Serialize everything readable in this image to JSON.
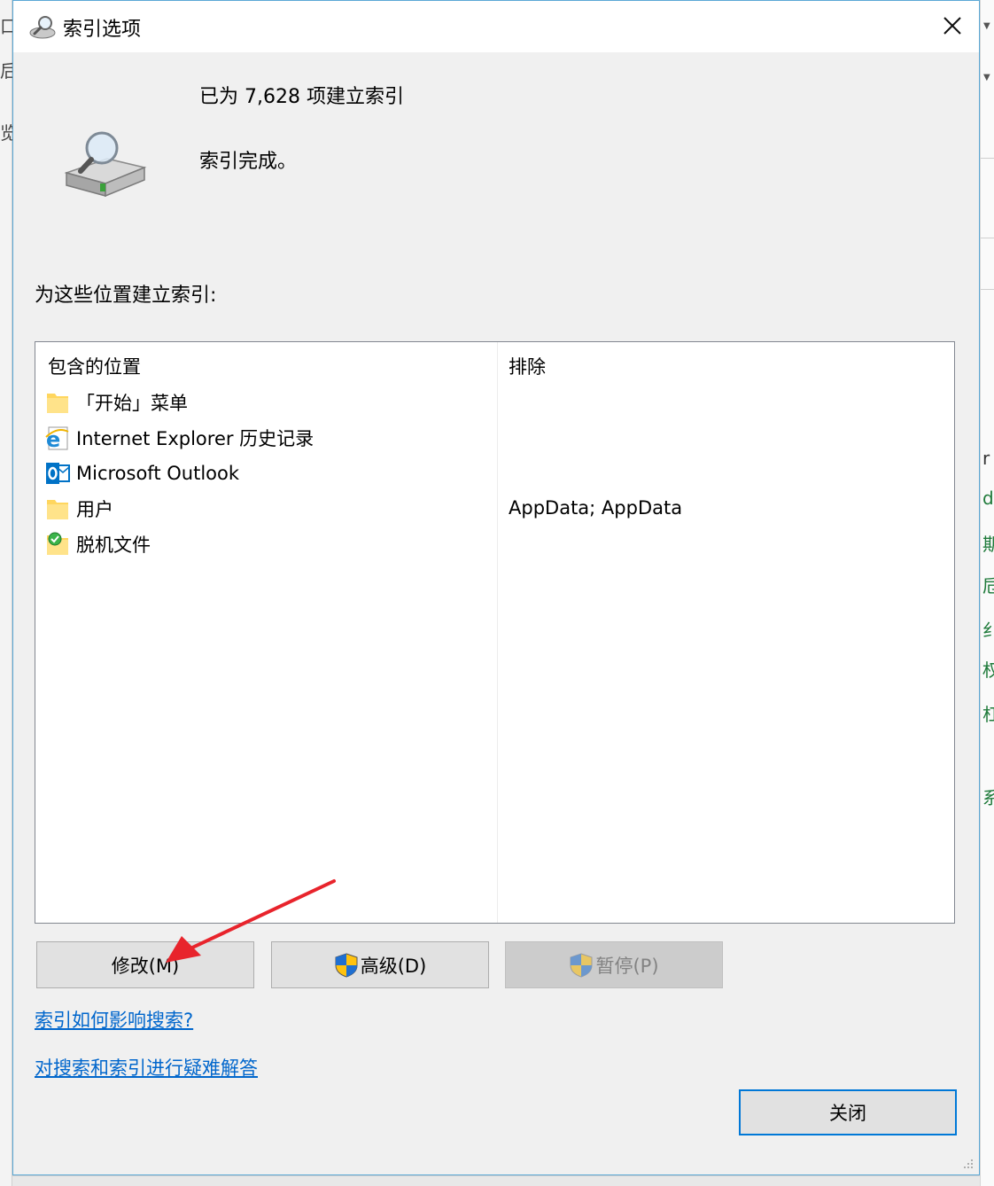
{
  "background": {
    "left_fragments": [
      "口",
      "后",
      "览"
    ],
    "right_glyphs": [
      "r",
      "d",
      "期",
      "卮",
      "纟",
      "权",
      "杠",
      "系"
    ]
  },
  "dialog": {
    "title": "索引选项",
    "title_icon": "search-indexer-icon",
    "close_glyph": "×",
    "indexed_count_text": "已为 7,628 项建立索引",
    "status_text": "索引完成。",
    "locations_label": "为这些位置建立索引:",
    "list": {
      "header_included": "包含的位置",
      "header_excluded": "排除",
      "rows": [
        {
          "label": "「开始」菜单",
          "icon": "folder-icon",
          "excluded": ""
        },
        {
          "label": "Internet Explorer 历史记录",
          "icon": "internet-explorer-icon",
          "excluded": ""
        },
        {
          "label": "Microsoft Outlook",
          "icon": "outlook-icon",
          "excluded": ""
        },
        {
          "label": "用户",
          "icon": "folder-icon",
          "excluded": "AppData; AppData"
        },
        {
          "label": "脱机文件",
          "icon": "offline-files-icon",
          "excluded": ""
        }
      ]
    },
    "buttons": {
      "modify": "修改(M)",
      "advanced": "高级(D)",
      "pause": "暂停(P)",
      "close": "关闭"
    },
    "links": {
      "how_affects": "索引如何影响搜索?",
      "troubleshoot": "对搜索和索引进行疑难解答"
    },
    "colors": {
      "link": "#0066cc",
      "accent": "#0078d7",
      "annotation_arrow": "#e8242c"
    }
  }
}
